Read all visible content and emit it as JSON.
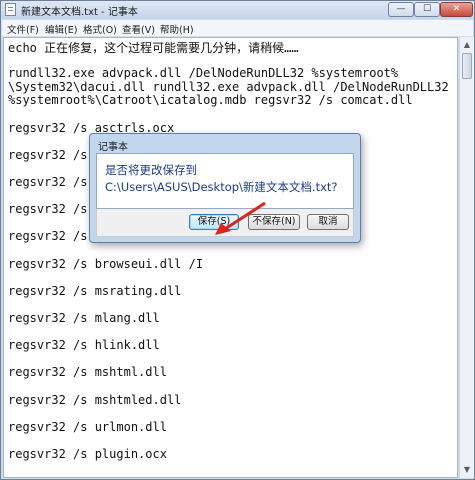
{
  "window": {
    "title": "新建文本文档.txt - 记事本",
    "controls": {
      "minimize": "—",
      "maximize": "☐",
      "close": "✕"
    }
  },
  "menu": [
    "文件(F)",
    "编辑(E)",
    "格式(O)",
    "查看(V)",
    "帮助(H)"
  ],
  "editor_lines": [
    "echo 正在修复，这个过程可能需要几分钟，请稍候……",
    "",
    "rundll32.exe advpack.dll /DelNodeRunDLL32 %systemroot%",
    "\\System32\\dacui.dll rundll32.exe advpack.dll /DelNodeRunDLL32",
    "%systemroot%\\Catroot\\icatalog.mdb regsvr32 /s comcat.dll",
    "",
    "regsvr32 /s asctrls.ocx",
    "",
    "regsvr32 /s",
    "",
    "regsvr32 /s",
    "",
    "regsvr32 /s",
    "",
    "regsvr32 /s",
    "",
    "regsvr32 /s browseui.dll /I",
    "",
    "regsvr32 /s msrating.dll",
    "",
    "regsvr32 /s mlang.dll",
    "",
    "regsvr32 /s hlink.dll",
    "",
    "regsvr32 /s mshtml.dll",
    "",
    "regsvr32 /s mshtmled.dll",
    "",
    "regsvr32 /s urlmon.dll",
    "",
    "regsvr32 /s plugin.ocx"
  ],
  "dialog": {
    "title": "记事本",
    "message": "是否将更改保存到 C:\\Users\\ASUS\\Desktop\\新建文本文档.txt?",
    "buttons": {
      "save": "保存(S)",
      "dont_save": "不保存(N)",
      "cancel": "取消"
    }
  },
  "colors": {
    "message": "#1a3c8f",
    "annotation_arrow": "#e0221b",
    "titlebar": "#c4d5ea"
  },
  "icons": [
    "notepad-icon",
    "scroll-up-arrow-icon",
    "scroll-down-arrow-icon"
  ]
}
